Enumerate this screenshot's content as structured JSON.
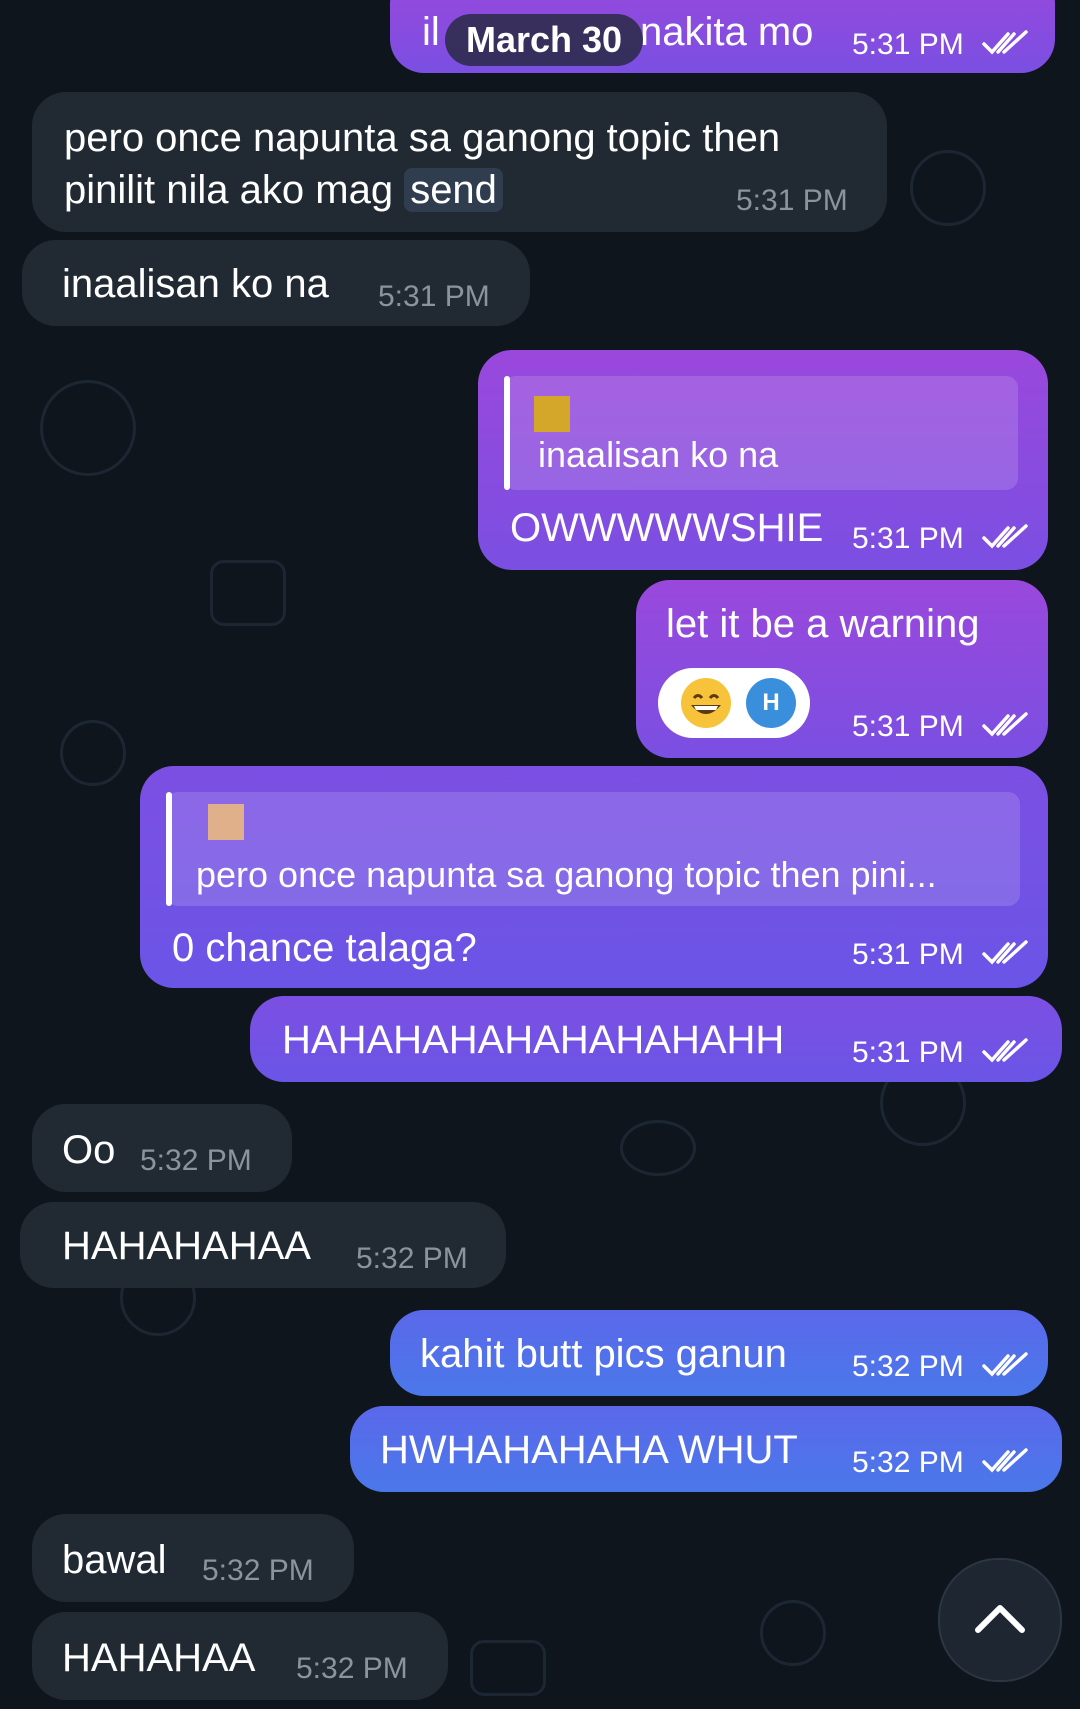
{
  "date_badge": "March 30",
  "messages": [
    {
      "text": "il",
      "text_tail": "nakita mo",
      "time": "5:31 PM",
      "read": true
    },
    {
      "text_line1": "pero once napunta sa ganong topic then",
      "text_line2_pre": "pinilit nila ako mag ",
      "text_line2_highlight": "send",
      "time": "5:31 PM"
    },
    {
      "text": "inaalisan ko na",
      "time": "5:31 PM"
    },
    {
      "reply_preview": "inaalisan ko na",
      "text": "OWWWWWSHIE",
      "time": "5:31 PM",
      "read": true
    },
    {
      "text": "let it be a warning",
      "time": "5:31 PM",
      "read": true,
      "reaction": {
        "emoji": "grinning-face",
        "avatar_letter": "H"
      }
    },
    {
      "reply_preview": "pero once napunta sa ganong topic then pini...",
      "text": "0 chance talaga?",
      "time": "5:31 PM",
      "read": true
    },
    {
      "text": "HAHAHAHAHAHAHAHAHH",
      "time": "5:31 PM",
      "read": true
    },
    {
      "text": "Oo",
      "time": "5:32 PM"
    },
    {
      "text": "HAHAHAHAA",
      "time": "5:32 PM"
    },
    {
      "text": "kahit butt pics ganun",
      "time": "5:32 PM",
      "read": true
    },
    {
      "text": "HWHAHAHAHA WHUT",
      "time": "5:32 PM",
      "read": true
    },
    {
      "text": "bawal",
      "time": "5:32 PM"
    },
    {
      "text": "HAHAHAA",
      "time": "5:32 PM"
    }
  ],
  "icons": {
    "read_receipt": "double-check-icon",
    "scroll_button": "chevron-up-icon"
  },
  "colors": {
    "background": "#0f151d",
    "incoming_bubble": "#212a33",
    "outgoing_violet": "#9a48dc",
    "outgoing_mid": "#7c4fe3",
    "outgoing_blue": "#4a78ea"
  }
}
